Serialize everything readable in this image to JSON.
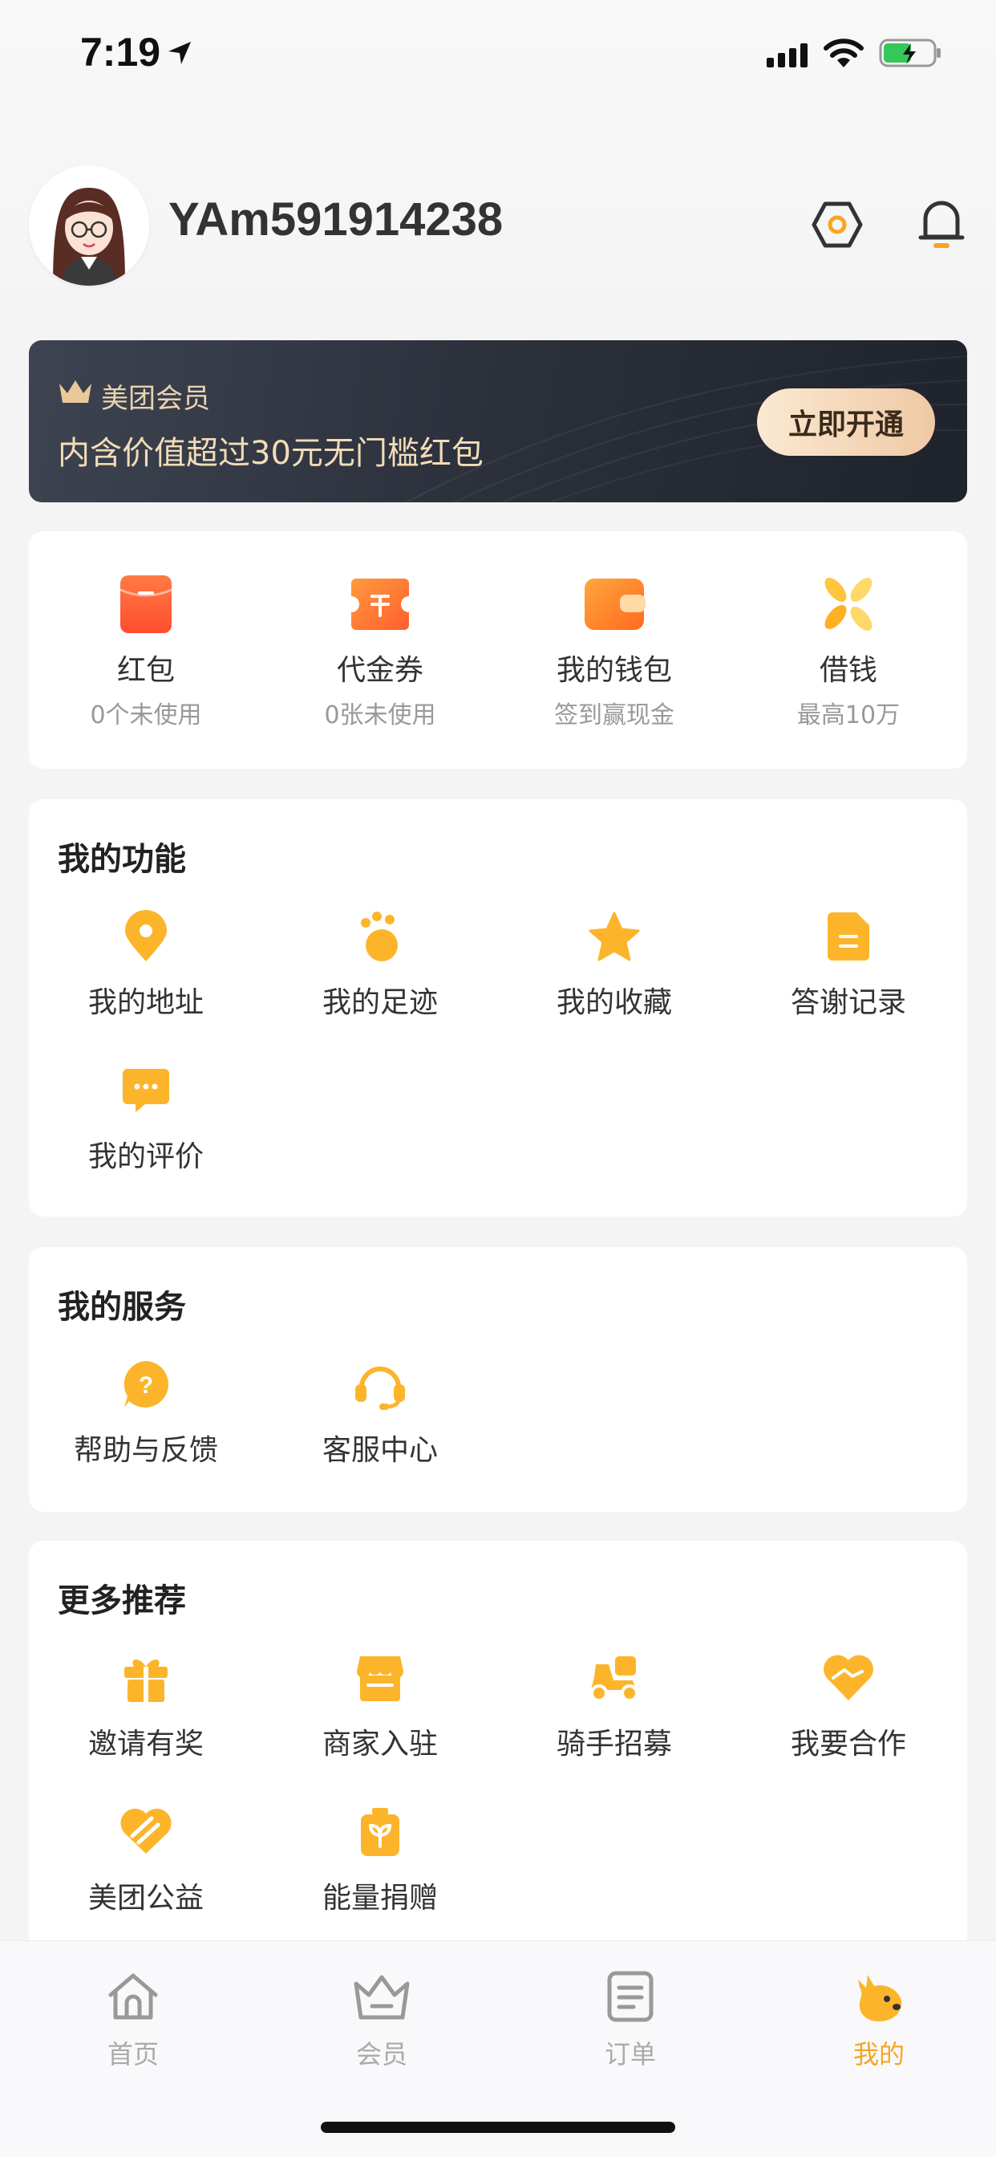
{
  "status": {
    "time": "7:19"
  },
  "profile": {
    "username": "YAm591914238"
  },
  "member": {
    "title": "美团会员",
    "desc": "内含价值超过30元无门槛红包",
    "button": "立即开通"
  },
  "assets": [
    {
      "label": "红包",
      "sub": "0个未使用",
      "icon": "red-packet-icon"
    },
    {
      "label": "代金券",
      "sub": "0张未使用",
      "icon": "voucher-icon"
    },
    {
      "label": "我的钱包",
      "sub": "签到赢现金",
      "icon": "wallet-icon"
    },
    {
      "label": "借钱",
      "sub": "最高10万",
      "icon": "loan-icon"
    }
  ],
  "functions": {
    "title": "我的功能",
    "items": [
      {
        "label": "我的地址",
        "icon": "location-pin-icon"
      },
      {
        "label": "我的足迹",
        "icon": "footprint-icon"
      },
      {
        "label": "我的收藏",
        "icon": "star-icon"
      },
      {
        "label": "答谢记录",
        "icon": "document-icon"
      },
      {
        "label": "我的评价",
        "icon": "comment-icon"
      }
    ]
  },
  "services": {
    "title": "我的服务",
    "items": [
      {
        "label": "帮助与反馈",
        "icon": "help-icon"
      },
      {
        "label": "客服中心",
        "icon": "headset-icon"
      }
    ]
  },
  "more": {
    "title": "更多推荐",
    "items": [
      {
        "label": "邀请有奖",
        "icon": "gift-icon"
      },
      {
        "label": "商家入驻",
        "icon": "store-icon"
      },
      {
        "label": "骑手招募",
        "icon": "rider-icon"
      },
      {
        "label": "我要合作",
        "icon": "handshake-heart-icon"
      },
      {
        "label": "美团公益",
        "icon": "charity-icon"
      },
      {
        "label": "能量捐赠",
        "icon": "energy-icon"
      }
    ]
  },
  "tabs": [
    {
      "label": "首页",
      "icon": "home-icon"
    },
    {
      "label": "会员",
      "icon": "crown-icon"
    },
    {
      "label": "订单",
      "icon": "order-icon"
    },
    {
      "label": "我的",
      "icon": "kangaroo-icon"
    }
  ],
  "colors": {
    "accent": "#f5a623",
    "icon_yellow": "#fcb52a",
    "banner_gold": "#e9d3b0"
  }
}
